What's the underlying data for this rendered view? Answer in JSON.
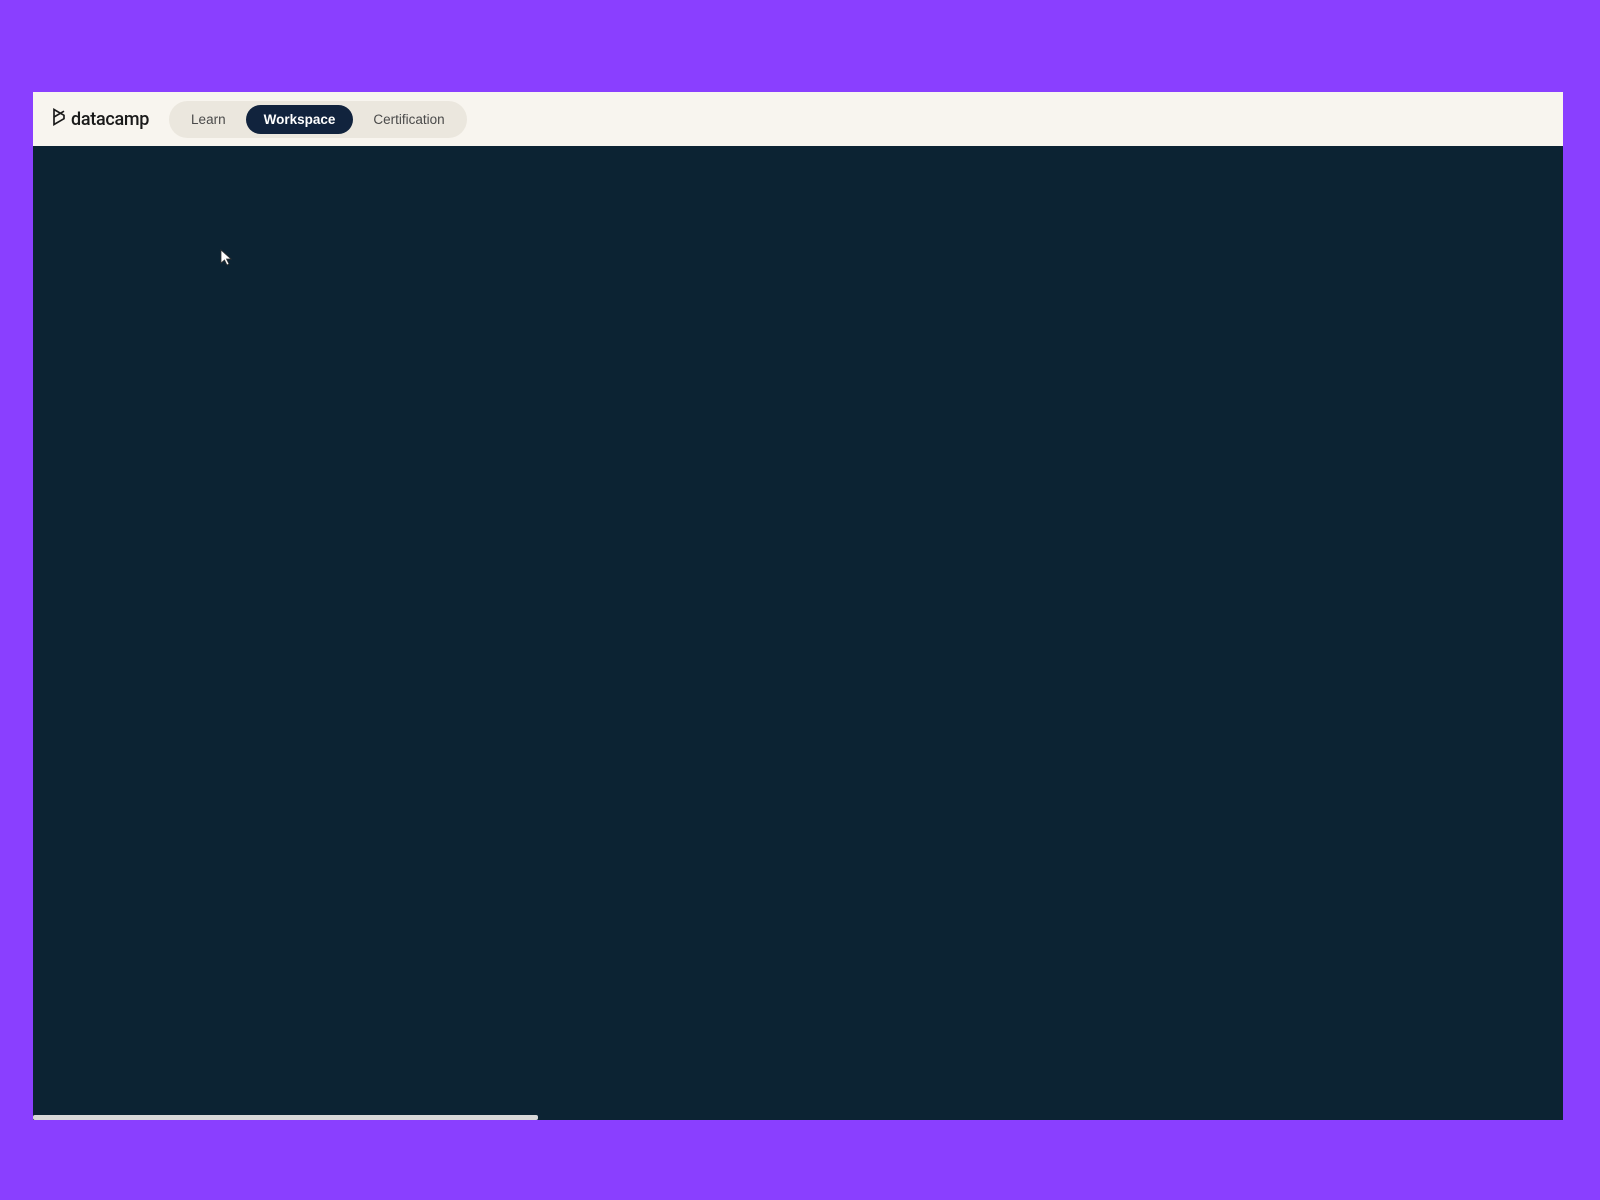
{
  "brand": {
    "name": "datacamp"
  },
  "nav": {
    "tabs": [
      {
        "label": "Learn",
        "active": false
      },
      {
        "label": "Workspace",
        "active": true
      },
      {
        "label": "Certification",
        "active": false
      }
    ]
  },
  "colors": {
    "background": "#8a3fff",
    "topbar": "#f8f5ef",
    "content": "#0c2333",
    "tabGroup": "#ebe7de",
    "activeTab": "#11233d"
  }
}
